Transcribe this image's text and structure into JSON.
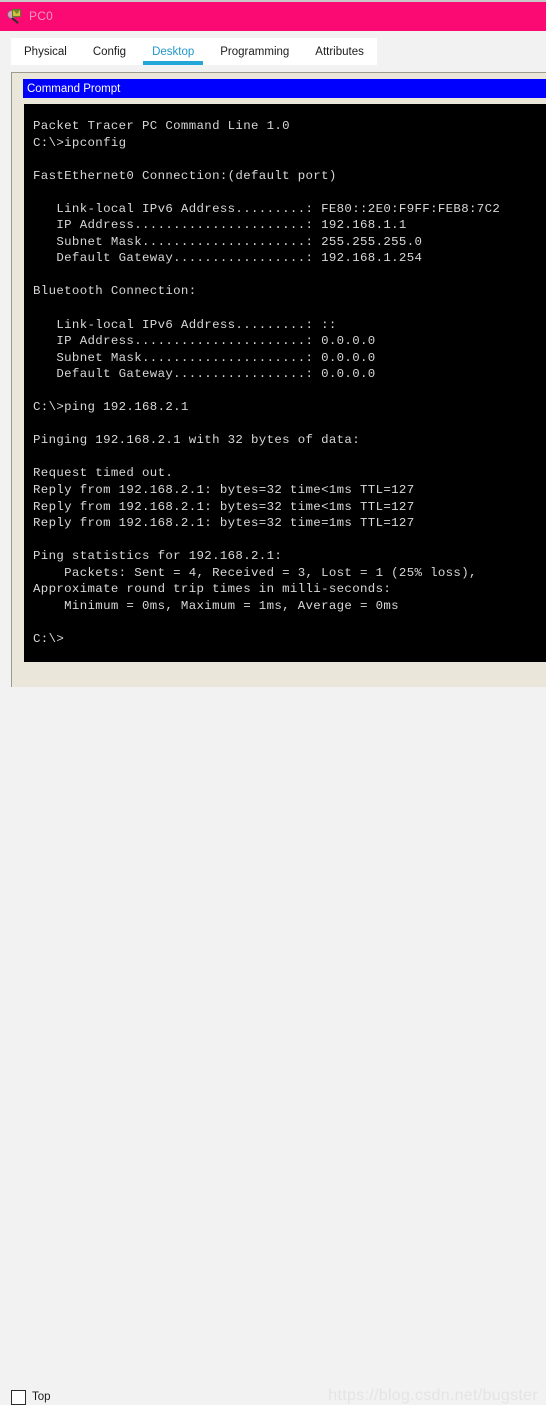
{
  "window": {
    "title": "PC0",
    "icon": "packet-tracer-icon",
    "titlebar_color": "#fa0a72",
    "title_text_color": "#ef9ac0"
  },
  "tabs": {
    "active_index": 2,
    "accent_color": "#24a7d8",
    "items": [
      {
        "label": "Physical"
      },
      {
        "label": "Config"
      },
      {
        "label": "Desktop"
      },
      {
        "label": "Programming"
      },
      {
        "label": "Attributes"
      }
    ]
  },
  "app_panel": {
    "header_label": "Command Prompt",
    "header_bg": "#0000ff",
    "header_fg": "#ffffff",
    "panel_bg": "#eae7da"
  },
  "terminal": {
    "bg": "#000000",
    "fg": "#d8d8d8",
    "lines": [
      "Packet Tracer PC Command Line 1.0",
      "C:\\>ipconfig",
      "",
      "FastEthernet0 Connection:(default port)",
      "",
      "   Link-local IPv6 Address.........: FE80::2E0:F9FF:FEB8:7C2",
      "   IP Address......................: 192.168.1.1",
      "   Subnet Mask.....................: 255.255.255.0",
      "   Default Gateway.................: 192.168.1.254",
      "",
      "Bluetooth Connection:",
      "",
      "   Link-local IPv6 Address.........: ::",
      "   IP Address......................: 0.0.0.0",
      "   Subnet Mask.....................: 0.0.0.0",
      "   Default Gateway.................: 0.0.0.0",
      "",
      "C:\\>ping 192.168.2.1",
      "",
      "Pinging 192.168.2.1 with 32 bytes of data:",
      "",
      "Request timed out.",
      "Reply from 192.168.2.1: bytes=32 time<1ms TTL=127",
      "Reply from 192.168.2.1: bytes=32 time<1ms TTL=127",
      "Reply from 192.168.2.1: bytes=32 time=1ms TTL=127",
      "",
      "Ping statistics for 192.168.2.1:",
      "    Packets: Sent = 4, Received = 3, Lost = 1 (25% loss),",
      "Approximate round trip times in milli-seconds:",
      "    Minimum = 0ms, Maximum = 1ms, Average = 0ms",
      "",
      "C:\\>"
    ]
  },
  "footer": {
    "top_checkbox_label": "Top",
    "top_checkbox_checked": false,
    "watermark": "https://blog.csdn.net/bugster"
  }
}
